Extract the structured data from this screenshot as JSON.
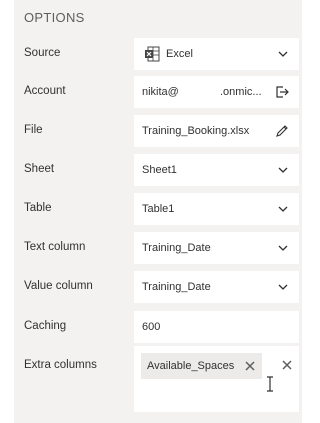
{
  "header": {
    "title": "OPTIONS"
  },
  "rows": [
    {
      "label": "Source",
      "value": "Excel"
    },
    {
      "label": "Account",
      "value_prefix": "nikita@",
      "value_suffix": ".onmic..."
    },
    {
      "label": "File",
      "value": "Training_Booking.xlsx"
    },
    {
      "label": "Sheet",
      "value": "Sheet1"
    },
    {
      "label": "Table",
      "value": "Table1"
    },
    {
      "label": "Text column",
      "value": "Training_Date"
    },
    {
      "label": "Value column",
      "value": "Training_Date"
    },
    {
      "label": "Caching",
      "value": "600"
    },
    {
      "label": "Extra columns",
      "tags": [
        "Available_Spaces"
      ]
    }
  ],
  "colors": {
    "panel_bg": "#f3f2f1",
    "text": "#323130",
    "header": "#605e5c",
    "excel_green": "#107c41"
  },
  "icons": [
    "excel-icon",
    "signout-icon",
    "pencil-icon",
    "chevron-down-icon",
    "close-icon",
    "text-cursor-icon"
  ]
}
